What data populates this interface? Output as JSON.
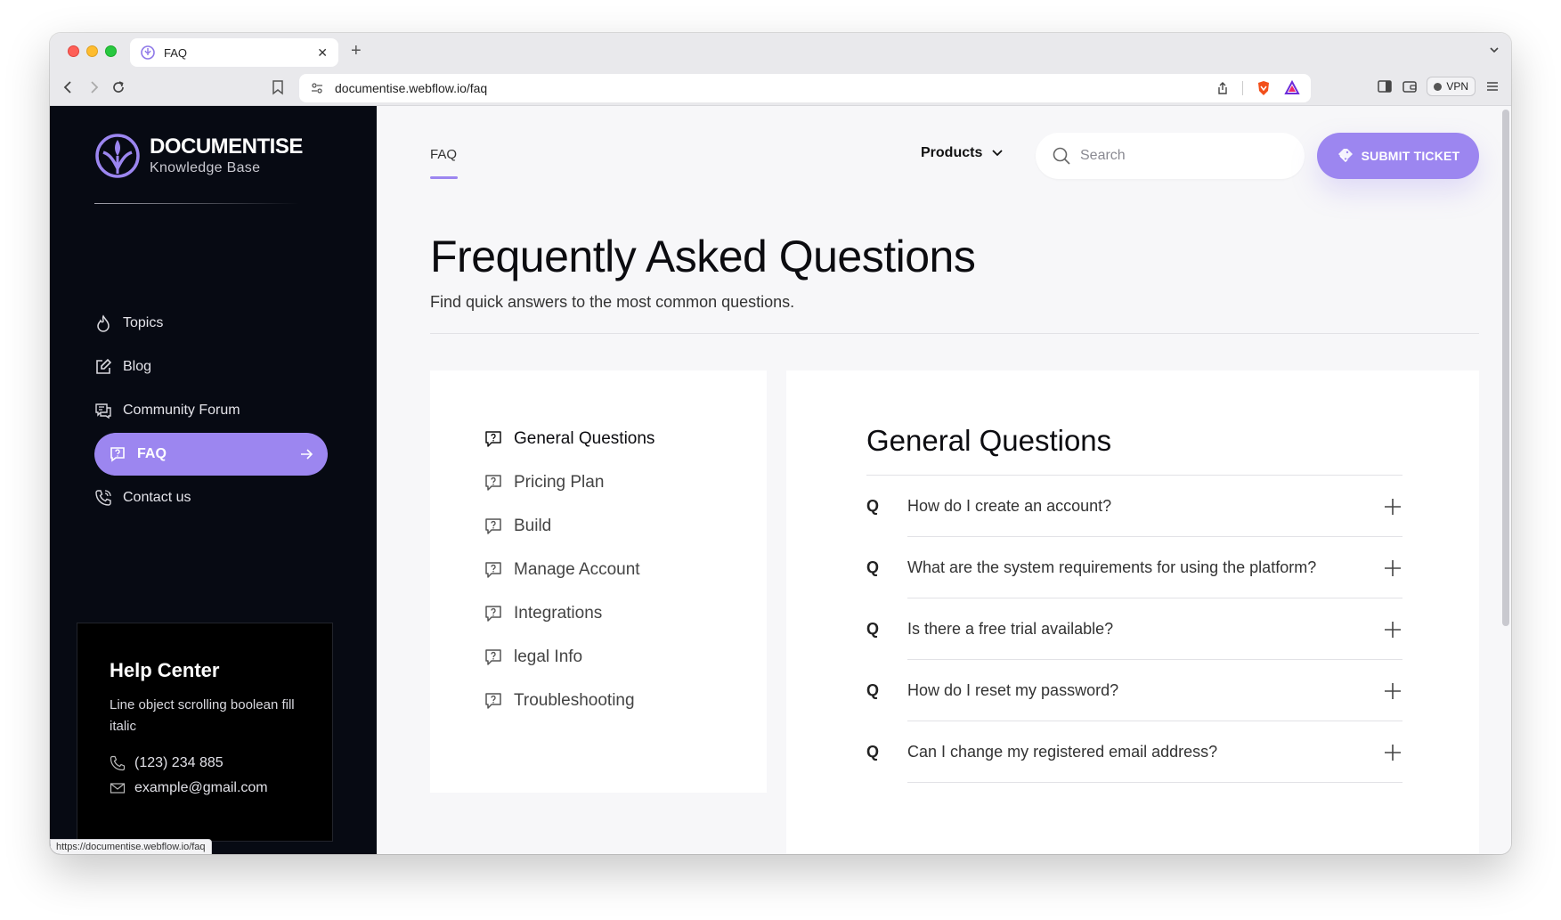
{
  "browser": {
    "tab_title": "FAQ",
    "url": "documentise.webflow.io/faq",
    "vpn_label": "VPN",
    "status_url": "https://documentise.webflow.io/faq"
  },
  "sidebar": {
    "brand_name": "DOCUMENTISE",
    "brand_sub": "Knowledge Base",
    "items": [
      {
        "label": "Topics",
        "icon": "flame-icon"
      },
      {
        "label": "Blog",
        "icon": "edit-icon"
      },
      {
        "label": "Community Forum",
        "icon": "forum-icon"
      },
      {
        "label": "FAQ",
        "icon": "chat-question-icon",
        "active": true
      },
      {
        "label": "Contact us",
        "icon": "phone-icon"
      }
    ],
    "help": {
      "title": "Help Center",
      "description": "Line object scrolling boolean fill italic",
      "phone": "(123) 234 885",
      "email": "example@gmail.com"
    }
  },
  "header": {
    "nav_faq": "FAQ",
    "products_label": "Products",
    "search_placeholder": "Search",
    "submit_label": "SUBMIT TICKET"
  },
  "main": {
    "title": "Frequently Asked Questions",
    "subtitle": "Find quick answers to the most common questions.",
    "categories": [
      "General Questions",
      "Pricing Plan",
      "Build",
      "Manage Account",
      "Integrations",
      "legal Info",
      "Troubleshooting"
    ],
    "faq_section_title": "General Questions",
    "q_marker": "Q",
    "questions": [
      "How do I create an account?",
      "What are the system requirements for using the platform?",
      "Is there a free trial available?",
      "How do I reset my password?",
      "Can I change my registered email address?"
    ]
  },
  "colors": {
    "accent": "#9c86f0",
    "sidebar_bg": "#070a13",
    "page_bg": "#f7f7f9"
  }
}
